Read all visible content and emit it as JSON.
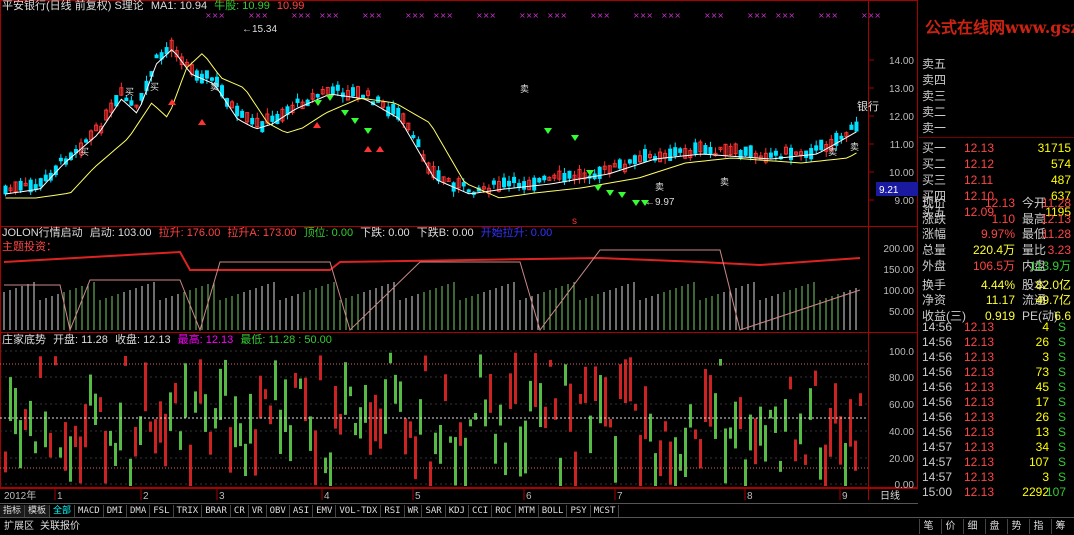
{
  "main_header": {
    "title": "平安银行(日线 前复权) S理论",
    "ma_label": "MA1: 10.94",
    "niu_label": "牛股: 10.99",
    "niu2": "10.99"
  },
  "main_annot": {
    "high": "15.34",
    "low": "9.97",
    "bank": "银行",
    "curval": "9.21",
    "mark_s": "s",
    "buy": "买",
    "sell": "卖"
  },
  "ind1_header": {
    "name": "JOLON行情启动",
    "v1": "启动: 103.00",
    "v2": "拉升: 176.00",
    "v3": "拉升A: 173.00",
    "v4": "顶位: 0.00",
    "v5": "下跌: 0.00",
    "v6": "下跌B: 0.00",
    "v7": "开始拉升: 0.00",
    "sub": "主题投资："
  },
  "ind2_header": {
    "name": "庄家底势",
    "open": "开盘: 11.28",
    "close": "收盘: 12.13",
    "high": "最高: 12.13",
    "low": "最低: 11.28 : 50.00"
  },
  "y_main": [
    "14.00",
    "13.00",
    "12.00",
    "11.00",
    "10.00",
    "9.00"
  ],
  "y_ind1": [
    "200.00",
    "150.00",
    "100.00",
    "50.00"
  ],
  "y_ind2": [
    "100.0",
    "80.00",
    "60.00",
    "40.00",
    "20.00",
    "0.00"
  ],
  "x_axis": {
    "year": "2012年",
    "months": [
      "1",
      "2",
      "3",
      "4",
      "5",
      "6",
      "7",
      "8",
      "9"
    ],
    "period": "日线"
  },
  "tabs": [
    "指标",
    "模板",
    "全部",
    "MACD",
    "DMI",
    "DMA",
    "FSL",
    "TRIX",
    "BRAR",
    "CR",
    "VR",
    "OBV",
    "ASI",
    "EMV",
    "VOL-TDX",
    "RSI",
    "WR",
    "SAR",
    "KDJ",
    "CCI",
    "ROC",
    "MTM",
    "BOLL",
    "PSY",
    "MCST"
  ],
  "bottom": {
    "expand": "扩展区",
    "related": "关联报价",
    "right_tabs": [
      "笔",
      "价",
      "细",
      "盘",
      "势",
      "指",
      "筹"
    ]
  },
  "panel": {
    "logo": "公式在线网www.gszx.com.cn",
    "asks": [
      {
        "label": "卖五",
        "price": "",
        "vol": ""
      },
      {
        "label": "卖四",
        "price": "",
        "vol": ""
      },
      {
        "label": "卖三",
        "price": "",
        "vol": ""
      },
      {
        "label": "卖二",
        "price": "",
        "vol": ""
      },
      {
        "label": "卖一",
        "price": "",
        "vol": ""
      }
    ],
    "bids": [
      {
        "label": "买一",
        "price": "12.13",
        "vol": "31715"
      },
      {
        "label": "买二",
        "price": "12.12",
        "vol": "574"
      },
      {
        "label": "买三",
        "price": "12.11",
        "vol": "487"
      },
      {
        "label": "买四",
        "price": "12.10",
        "vol": "637"
      },
      {
        "label": "买五",
        "price": "12.09",
        "vol": "1195"
      }
    ],
    "quote": [
      {
        "l1": "现价",
        "v1": "12.13",
        "c1": "red",
        "l2": "今开",
        "v2": "11.28",
        "c2": "red"
      },
      {
        "l1": "涨跌",
        "v1": "1.10",
        "c1": "red",
        "l2": "最高",
        "v2": "12.13",
        "c2": "red"
      },
      {
        "l1": "涨幅",
        "v1": "9.97%",
        "c1": "red",
        "l2": "最低",
        "v2": "11.28",
        "c2": "red"
      },
      {
        "l1": "总量",
        "v1": "220.4万",
        "c1": "yel",
        "l2": "量比",
        "v2": "3.23",
        "c2": "red"
      },
      {
        "l1": "外盘",
        "v1": "106.5万",
        "c1": "red",
        "l2": "内盘",
        "v2": "113.9万",
        "c2": "grn"
      },
      {
        "l1": "换手",
        "v1": "4.44%",
        "c1": "yel",
        "l2": "股本",
        "v2": "82.0亿",
        "c2": "yel"
      },
      {
        "l1": "净资",
        "v1": "11.17",
        "c1": "yel",
        "l2": "流通",
        "v2": "49.7亿",
        "c2": "yel"
      },
      {
        "l1": "收益(三)",
        "v1": "0.919",
        "c1": "yel",
        "l2": "PE(动)",
        "v2": "6.6",
        "c2": "yel"
      }
    ],
    "ticks": [
      {
        "t": "14:56",
        "p": "12.13",
        "v": "4",
        "s": "S"
      },
      {
        "t": "14:56",
        "p": "12.13",
        "v": "26",
        "s": "S"
      },
      {
        "t": "14:56",
        "p": "12.13",
        "v": "3",
        "s": "S"
      },
      {
        "t": "14:56",
        "p": "12.13",
        "v": "73",
        "s": "S"
      },
      {
        "t": "14:56",
        "p": "12.13",
        "v": "45",
        "s": "S"
      },
      {
        "t": "14:56",
        "p": "12.13",
        "v": "17",
        "s": "S"
      },
      {
        "t": "14:56",
        "p": "12.13",
        "v": "26",
        "s": "S"
      },
      {
        "t": "14:56",
        "p": "12.13",
        "v": "13",
        "s": "S"
      },
      {
        "t": "14:57",
        "p": "12.13",
        "v": "34",
        "s": "S"
      },
      {
        "t": "14:57",
        "p": "12.13",
        "v": "107",
        "s": "S"
      },
      {
        "t": "14:57",
        "p": "12.13",
        "v": "3",
        "s": "S"
      },
      {
        "t": "15:00",
        "p": "12.13",
        "v": "2292",
        "s": "107"
      }
    ]
  },
  "colors": {
    "up": "#ff3333",
    "down": "#33cc33",
    "grid": "#7a0000",
    "axis": "#aa0000"
  }
}
